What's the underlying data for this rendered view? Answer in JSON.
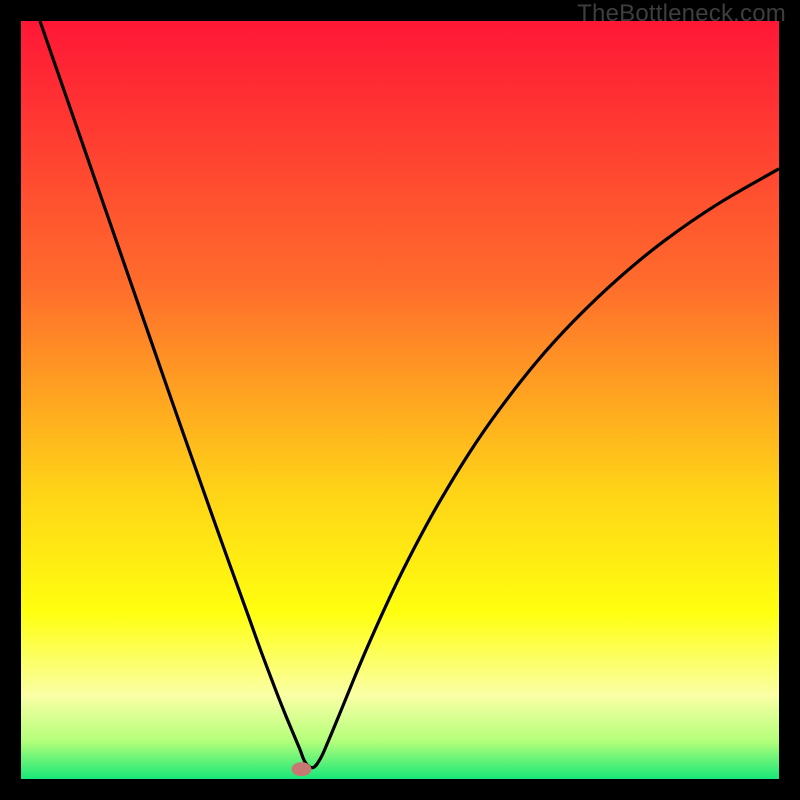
{
  "source_label": "TheBottleneck.com",
  "colors": {
    "top": "#ff1736",
    "mid1": "#ff6d2c",
    "mid2": "#ffd317",
    "mid3": "#ffff0f",
    "mid4": "#faffa6",
    "mid5": "#b4ff7a",
    "bottom": "#17e778",
    "curve": "#000000",
    "marker": "#c77873",
    "frame": "#000000"
  },
  "chart_data": {
    "type": "line",
    "title": "",
    "xlabel": "",
    "ylabel": "",
    "xlim": [
      0,
      100
    ],
    "ylim": [
      0,
      100
    ],
    "annotations": [
      "TheBottleneck.com"
    ],
    "marker": {
      "x": 37,
      "y": 1.3
    },
    "series": [
      {
        "name": "bottleneck-curve",
        "x": [
          2.5,
          5,
          7.5,
          10,
          12.5,
          15,
          17.5,
          20,
          22.5,
          25,
          27.5,
          30,
          31.5,
          33,
          34,
          35,
          36,
          36.8,
          37.5,
          38.5,
          39.5,
          40.5,
          42,
          44,
          46,
          49,
          52,
          55,
          59,
          63,
          68,
          73,
          79,
          85,
          92,
          100
        ],
        "values": [
          100,
          92.8,
          85.6,
          78.4,
          71.2,
          64,
          56.8,
          49.6,
          42.5,
          35.4,
          28.4,
          21.5,
          17.3,
          13.3,
          10.7,
          8.2,
          5.8,
          3.9,
          2.2,
          1.5,
          2.7,
          4.9,
          8.5,
          13.4,
          18.1,
          24.7,
          30.7,
          36.2,
          42.8,
          48.6,
          55,
          60.5,
          66.2,
          71.1,
          75.9,
          80.5
        ]
      }
    ]
  }
}
